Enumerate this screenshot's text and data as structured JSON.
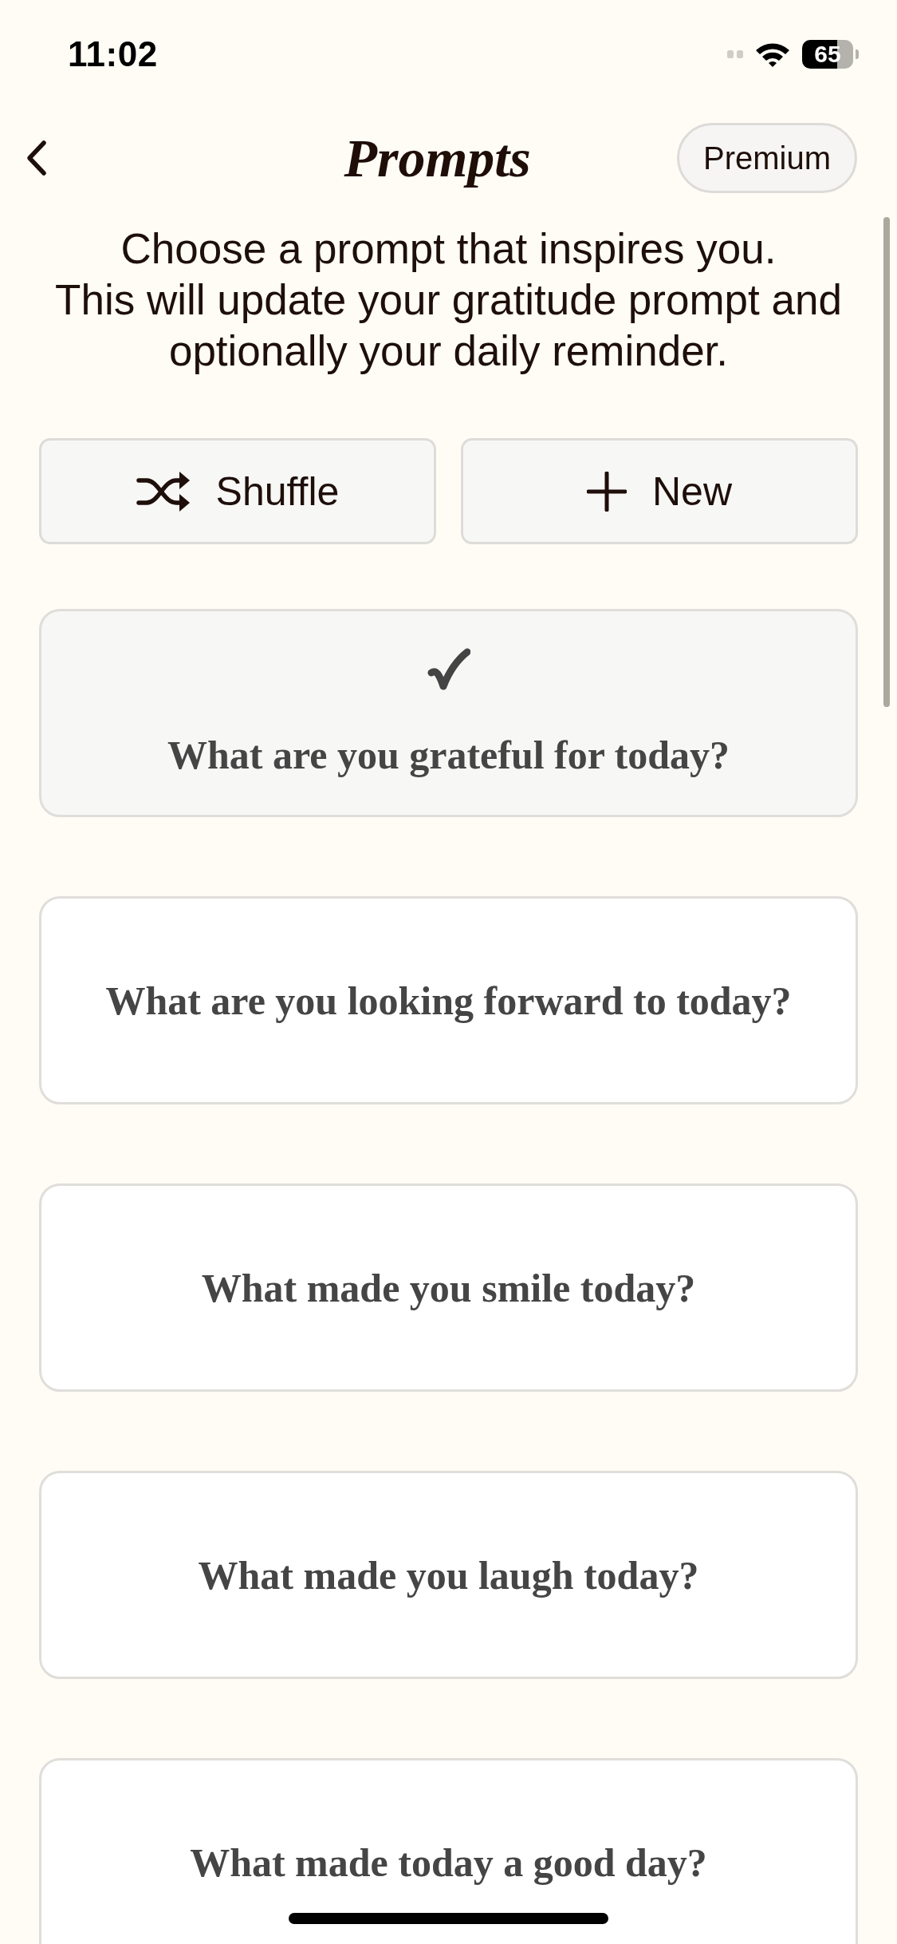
{
  "status_bar": {
    "time": "11:02",
    "battery": "65"
  },
  "header": {
    "title": "Prompts",
    "premium_button": "Premium"
  },
  "description": [
    "Choose a prompt that inspires you.",
    "This will update your gratitude prompt and optionally your daily reminder."
  ],
  "actions": [
    {
      "kind": "shuffle",
      "label": "Shuffle"
    },
    {
      "kind": "new",
      "label": "New"
    }
  ],
  "prompts": [
    {
      "text": "What are you grateful for today?",
      "selected": true
    },
    {
      "text": "What are you looking forward to today?",
      "selected": false
    },
    {
      "text": "What made you smile today?",
      "selected": false
    },
    {
      "text": "What made you laugh today?",
      "selected": false
    },
    {
      "text": "What made today a good day?",
      "selected": false
    }
  ]
}
